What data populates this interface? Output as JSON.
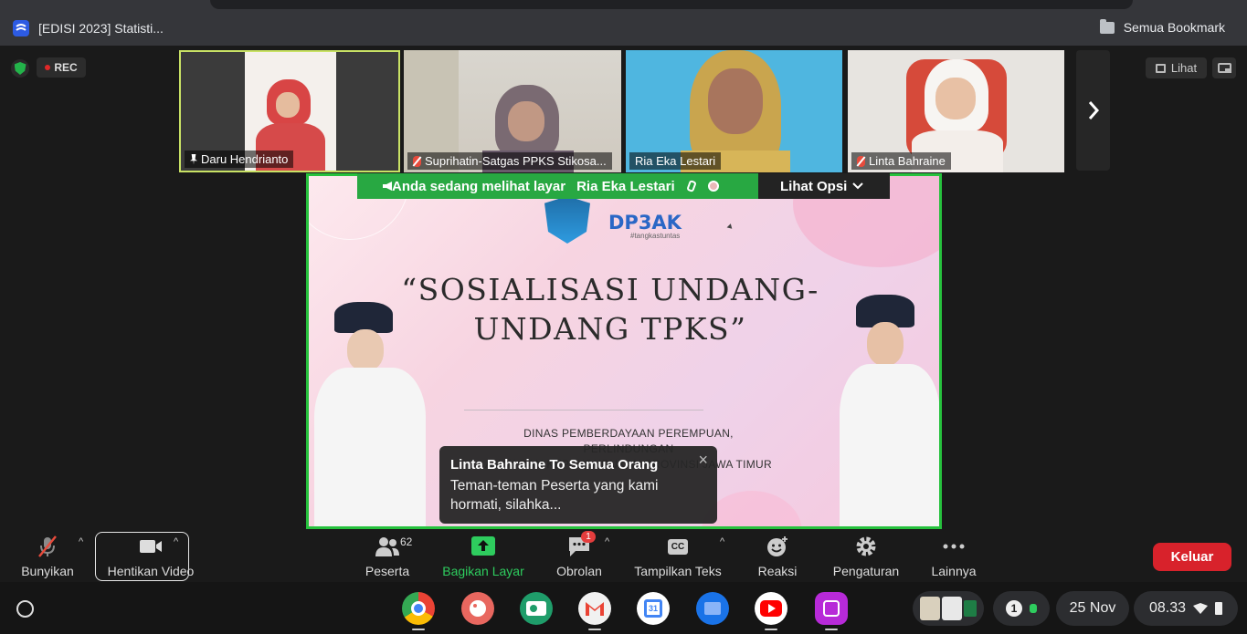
{
  "browser": {
    "tab_title": "[EDISI 2023] Statisti...",
    "bookmarks_label": "Semua Bookmark"
  },
  "meeting": {
    "recording_label": "REC",
    "view_label": "Lihat",
    "participants": [
      {
        "name": "Daru Hendrianto",
        "status": "pinned"
      },
      {
        "name": "Suprihatin-Satgas PPKS Stikosa...",
        "status": "muted"
      },
      {
        "name": "Ria Eka Lestari",
        "status": "none"
      },
      {
        "name": "Linta Bahraine",
        "status": "muted"
      }
    ],
    "share_banner": {
      "text": "Anda sedang melihat layar",
      "sharer": "Ria Eka Lestari",
      "options_label": "Lihat Opsi"
    },
    "slide": {
      "logo_text": "DP3AK",
      "logo_sub": "#tangkastuntas",
      "title": "“SOSIALISASI UNDANG-UNDANG TPKS”",
      "dept_line1": "DINAS PEMBERDAYAAN PEREMPUAN, PERLINDUNGAN",
      "dept_line2": "ANAK DAN KEPENDUDUKAN PROVINSI JAWA TIMUR"
    },
    "chat_popup": {
      "from": "Linta Bahraine To Semua Orang",
      "message": "Teman-teman Peserta yang kami hormati, silahka...",
      "close": "×"
    }
  },
  "toolbar": {
    "unmute_label": "Bunyikan",
    "stop_video_label": "Hentikan Video",
    "participants_label": "Peserta",
    "participants_count": "62",
    "share_label": "Bagikan Layar",
    "chat_label": "Obrolan",
    "chat_badge": "1",
    "captions_label": "Tampilkan Teks",
    "captions_icon_text": "CC",
    "reactions_label": "Reaksi",
    "settings_label": "Pengaturan",
    "more_label": "Lainnya",
    "leave_label": "Keluar",
    "share_accent": "#2ecc5e",
    "leave_color": "#d8222b"
  },
  "shelf": {
    "notification_count": "1",
    "date": "25 Nov",
    "time": "08.33",
    "apps": [
      "chrome-icon",
      "canvas-icon",
      "classroom-icon",
      "gmail-icon",
      "calendar-icon",
      "files-icon",
      "youtube-icon",
      "gallery-icon"
    ],
    "calendar_day": "31"
  }
}
